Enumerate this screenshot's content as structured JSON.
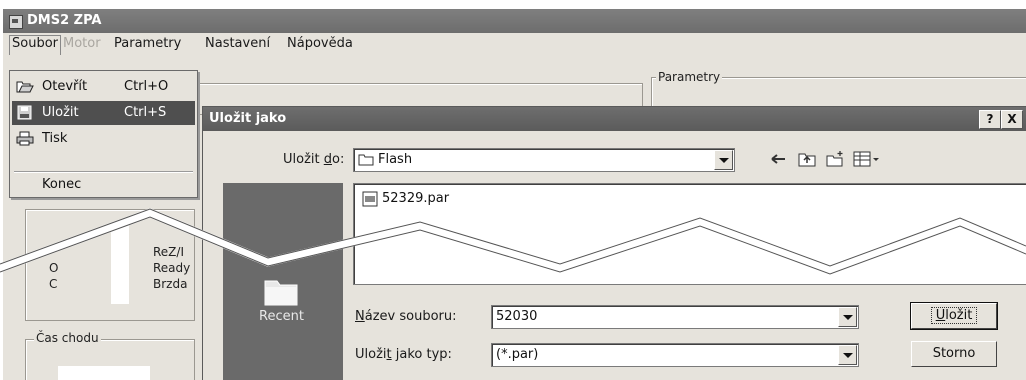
{
  "main_window": {
    "title": "DMS2 ZPA",
    "menu": [
      "Soubor",
      "Motor",
      "Parametry",
      "Nastavení",
      "Nápověda"
    ],
    "groups": {
      "parametry": "Parametry",
      "cas_chodu": "Čas chodu"
    },
    "status_letters": [
      "O",
      "C"
    ],
    "status_labels": [
      "ReZ/I",
      "Ready",
      "Brzda"
    ]
  },
  "file_menu": {
    "items": [
      {
        "label": "Otevřít",
        "shortcut": "Ctrl+O",
        "icon": "open-folder-icon"
      },
      {
        "label": "Uložit",
        "shortcut": "Ctrl+S",
        "icon": "floppy-disk-icon",
        "active": true
      },
      {
        "label": "Tisk",
        "shortcut": "",
        "icon": "printer-icon"
      },
      {
        "label": "Konec",
        "shortcut": ""
      }
    ]
  },
  "dialog": {
    "title": "Uložit jako",
    "help_btn": "?",
    "close_btn": "X",
    "save_in_label_pre": "Uložit ",
    "save_in_label_acc": "d",
    "save_in_label_post": "o:",
    "save_in_value": "Flash",
    "places": {
      "recent": "Recent"
    },
    "files": [
      "52329.par"
    ],
    "filename_label_acc": "N",
    "filename_label_post": "ázev souboru:",
    "filename_value": "52030",
    "filetype_label_pre": "Uloži",
    "filetype_label_acc": "t",
    "filetype_label_post": " jako typ:",
    "filetype_value": "(*.par)",
    "save_button_acc": "U",
    "save_button_post": "ložit",
    "cancel_button": "Storno",
    "toolbar_icons": [
      "back-arrow-icon",
      "up-folder-icon",
      "new-folder-icon",
      "view-menu-icon"
    ]
  },
  "colors": {
    "title_bar": "#6d6d6d",
    "menu_highlight": "#4f4f4f",
    "window_bg": "#e6e3dc"
  }
}
